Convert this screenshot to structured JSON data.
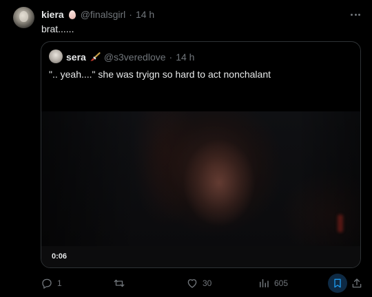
{
  "tweet": {
    "author_name": "kiera",
    "author_emoji_icon": "egg-icon",
    "author_handle": "@finalsgirl",
    "separator": "·",
    "time": "14 h",
    "text": "brat......"
  },
  "quote": {
    "author_name": "sera",
    "author_emoji_icon": "paintbrush-icon",
    "author_handle": "@s3veredlove",
    "separator": "·",
    "time": "14 h",
    "text": "\".. yeah....\" she was tryign so hard to act nonchalant",
    "video_duration": "0:06"
  },
  "actions": {
    "replies": "1",
    "reposts": "",
    "likes": "30",
    "views": "605"
  },
  "colors": {
    "background": "#000000",
    "text": "#e7e9ea",
    "muted": "#71767b",
    "border": "#2f3336"
  }
}
